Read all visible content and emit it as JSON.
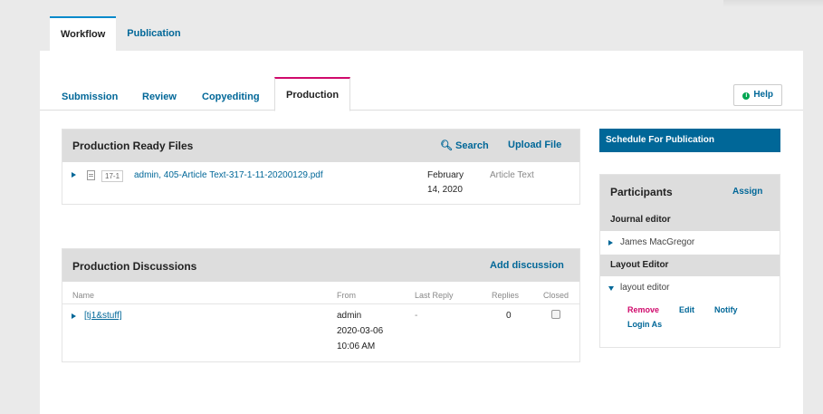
{
  "top_tabs": [
    "Workflow",
    "Publication"
  ],
  "stage_tabs": [
    "Submission",
    "Review",
    "Copyediting",
    "Production"
  ],
  "help_label": "Help",
  "production_files": {
    "title": "Production Ready Files",
    "search_label": "Search",
    "upload_label": "Upload File",
    "file": {
      "id": "17-1",
      "name": "admin, 405-Article Text-317-1-11-20200129.pdf",
      "date_line1": "February",
      "date_line2": "14, 2020",
      "type": "Article Text"
    }
  },
  "discussions": {
    "title": "Production Discussions",
    "add_label": "Add discussion",
    "columns": [
      "Name",
      "From",
      "Last Reply",
      "Replies",
      "Closed"
    ],
    "row": {
      "name": "[tj1&stuff]",
      "from_user": "admin",
      "from_date": "2020-03-06",
      "from_time": "10:06 AM",
      "last_reply": "-",
      "replies": "0"
    }
  },
  "schedule_button": "Schedule For Publication",
  "participants": {
    "title": "Participants",
    "assign_label": "Assign",
    "journal_editor_heading": "Journal editor",
    "journal_editor_name": "James MacGregor",
    "layout_editor_heading": "Layout Editor",
    "layout_editor_name": "layout editor",
    "actions": [
      "Remove",
      "Edit",
      "Notify",
      "Login As"
    ]
  },
  "colors": {
    "accent": "#006798",
    "remove": "#d00a6c",
    "active_stage": "#d00a6c",
    "active_top": "#008acb"
  }
}
